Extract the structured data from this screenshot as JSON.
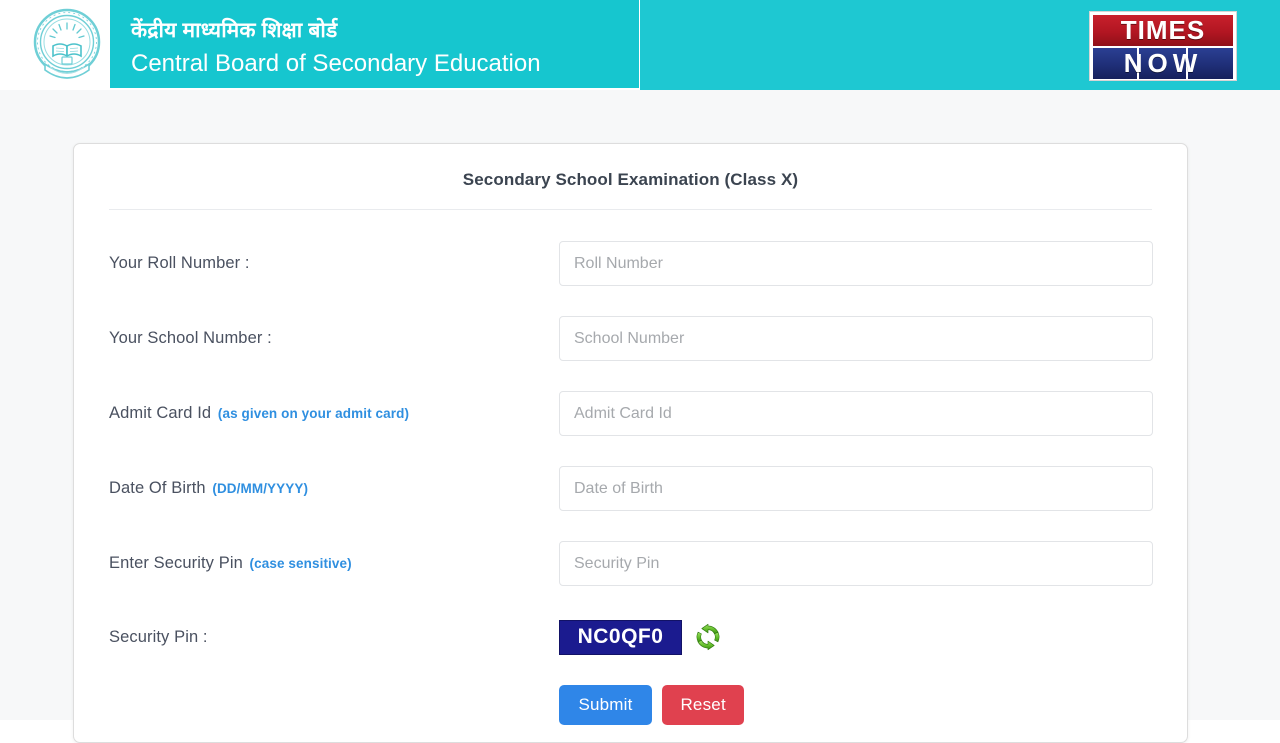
{
  "header": {
    "board_name_hindi": "केंद्रीय माध्यमिक शिक्षा बोर्ड",
    "board_name_english": "Central Board of Secondary Education",
    "emblem_alt": "CBSE emblem",
    "teal_color": "#1ec8d2",
    "watermark": {
      "top_word": "TIMES",
      "bottom_word": "NOW",
      "top_color": "#b21622",
      "bottom_color": "#1f2f78"
    }
  },
  "card": {
    "title": "Secondary School Examination (Class X)",
    "fields": [
      {
        "label": "Your Roll Number :",
        "hint": "",
        "placeholder": "Roll Number",
        "value": "",
        "name": "roll-number"
      },
      {
        "label": "Your School Number :",
        "hint": "",
        "placeholder": "School Number",
        "value": "",
        "name": "school-number"
      },
      {
        "label": "Admit Card Id",
        "hint": "(as given on your admit card)",
        "placeholder": "Admit Card Id",
        "value": "",
        "name": "admit-card-id"
      },
      {
        "label": "Date Of Birth",
        "hint": "(DD/MM/YYYY)",
        "placeholder": "Date of Birth",
        "value": "",
        "name": "date-of-birth"
      },
      {
        "label": "Enter Security Pin",
        "hint": "(case sensitive)",
        "placeholder": "Security Pin",
        "value": "",
        "name": "security-pin"
      }
    ],
    "captcha": {
      "label": "Security Pin :",
      "code": "NC0QF0",
      "background_color": "#1b1b8f",
      "refresh_icon": "refresh-icon",
      "refresh_icon_color": "#5cb82b"
    },
    "buttons": {
      "submit_label": "Submit",
      "reset_label": "Reset",
      "submit_color": "#2f86e8",
      "reset_color": "#e0414f"
    }
  }
}
